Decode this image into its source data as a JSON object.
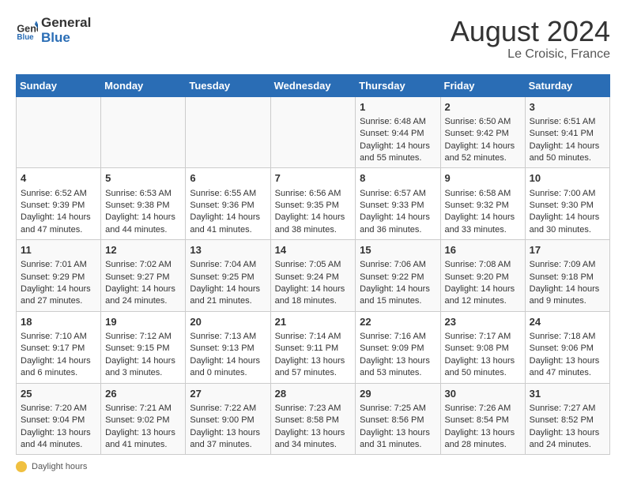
{
  "header": {
    "logo_general": "General",
    "logo_blue": "Blue",
    "month": "August 2024",
    "location": "Le Croisic, France"
  },
  "days_of_week": [
    "Sunday",
    "Monday",
    "Tuesday",
    "Wednesday",
    "Thursday",
    "Friday",
    "Saturday"
  ],
  "footer": {
    "label": "Daylight hours"
  },
  "weeks": [
    [
      {
        "day": "",
        "info": ""
      },
      {
        "day": "",
        "info": ""
      },
      {
        "day": "",
        "info": ""
      },
      {
        "day": "",
        "info": ""
      },
      {
        "day": "1",
        "info": "Sunrise: 6:48 AM\nSunset: 9:44 PM\nDaylight: 14 hours and 55 minutes."
      },
      {
        "day": "2",
        "info": "Sunrise: 6:50 AM\nSunset: 9:42 PM\nDaylight: 14 hours and 52 minutes."
      },
      {
        "day": "3",
        "info": "Sunrise: 6:51 AM\nSunset: 9:41 PM\nDaylight: 14 hours and 50 minutes."
      }
    ],
    [
      {
        "day": "4",
        "info": "Sunrise: 6:52 AM\nSunset: 9:39 PM\nDaylight: 14 hours and 47 minutes."
      },
      {
        "day": "5",
        "info": "Sunrise: 6:53 AM\nSunset: 9:38 PM\nDaylight: 14 hours and 44 minutes."
      },
      {
        "day": "6",
        "info": "Sunrise: 6:55 AM\nSunset: 9:36 PM\nDaylight: 14 hours and 41 minutes."
      },
      {
        "day": "7",
        "info": "Sunrise: 6:56 AM\nSunset: 9:35 PM\nDaylight: 14 hours and 38 minutes."
      },
      {
        "day": "8",
        "info": "Sunrise: 6:57 AM\nSunset: 9:33 PM\nDaylight: 14 hours and 36 minutes."
      },
      {
        "day": "9",
        "info": "Sunrise: 6:58 AM\nSunset: 9:32 PM\nDaylight: 14 hours and 33 minutes."
      },
      {
        "day": "10",
        "info": "Sunrise: 7:00 AM\nSunset: 9:30 PM\nDaylight: 14 hours and 30 minutes."
      }
    ],
    [
      {
        "day": "11",
        "info": "Sunrise: 7:01 AM\nSunset: 9:29 PM\nDaylight: 14 hours and 27 minutes."
      },
      {
        "day": "12",
        "info": "Sunrise: 7:02 AM\nSunset: 9:27 PM\nDaylight: 14 hours and 24 minutes."
      },
      {
        "day": "13",
        "info": "Sunrise: 7:04 AM\nSunset: 9:25 PM\nDaylight: 14 hours and 21 minutes."
      },
      {
        "day": "14",
        "info": "Sunrise: 7:05 AM\nSunset: 9:24 PM\nDaylight: 14 hours and 18 minutes."
      },
      {
        "day": "15",
        "info": "Sunrise: 7:06 AM\nSunset: 9:22 PM\nDaylight: 14 hours and 15 minutes."
      },
      {
        "day": "16",
        "info": "Sunrise: 7:08 AM\nSunset: 9:20 PM\nDaylight: 14 hours and 12 minutes."
      },
      {
        "day": "17",
        "info": "Sunrise: 7:09 AM\nSunset: 9:18 PM\nDaylight: 14 hours and 9 minutes."
      }
    ],
    [
      {
        "day": "18",
        "info": "Sunrise: 7:10 AM\nSunset: 9:17 PM\nDaylight: 14 hours and 6 minutes."
      },
      {
        "day": "19",
        "info": "Sunrise: 7:12 AM\nSunset: 9:15 PM\nDaylight: 14 hours and 3 minutes."
      },
      {
        "day": "20",
        "info": "Sunrise: 7:13 AM\nSunset: 9:13 PM\nDaylight: 14 hours and 0 minutes."
      },
      {
        "day": "21",
        "info": "Sunrise: 7:14 AM\nSunset: 9:11 PM\nDaylight: 13 hours and 57 minutes."
      },
      {
        "day": "22",
        "info": "Sunrise: 7:16 AM\nSunset: 9:09 PM\nDaylight: 13 hours and 53 minutes."
      },
      {
        "day": "23",
        "info": "Sunrise: 7:17 AM\nSunset: 9:08 PM\nDaylight: 13 hours and 50 minutes."
      },
      {
        "day": "24",
        "info": "Sunrise: 7:18 AM\nSunset: 9:06 PM\nDaylight: 13 hours and 47 minutes."
      }
    ],
    [
      {
        "day": "25",
        "info": "Sunrise: 7:20 AM\nSunset: 9:04 PM\nDaylight: 13 hours and 44 minutes."
      },
      {
        "day": "26",
        "info": "Sunrise: 7:21 AM\nSunset: 9:02 PM\nDaylight: 13 hours and 41 minutes."
      },
      {
        "day": "27",
        "info": "Sunrise: 7:22 AM\nSunset: 9:00 PM\nDaylight: 13 hours and 37 minutes."
      },
      {
        "day": "28",
        "info": "Sunrise: 7:23 AM\nSunset: 8:58 PM\nDaylight: 13 hours and 34 minutes."
      },
      {
        "day": "29",
        "info": "Sunrise: 7:25 AM\nSunset: 8:56 PM\nDaylight: 13 hours and 31 minutes."
      },
      {
        "day": "30",
        "info": "Sunrise: 7:26 AM\nSunset: 8:54 PM\nDaylight: 13 hours and 28 minutes."
      },
      {
        "day": "31",
        "info": "Sunrise: 7:27 AM\nSunset: 8:52 PM\nDaylight: 13 hours and 24 minutes."
      }
    ]
  ]
}
